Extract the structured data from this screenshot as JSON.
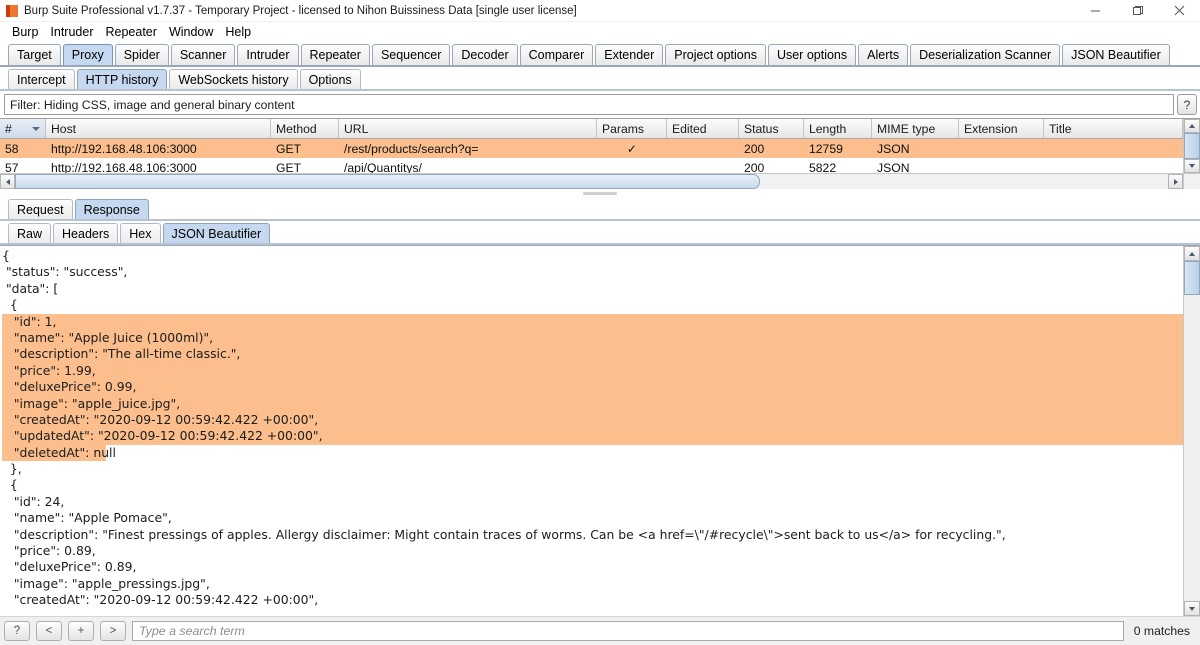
{
  "window": {
    "title": "Burp Suite Professional v1.7.37 - Temporary Project - licensed to Nihon Buissiness Data [single user license]",
    "minimize_label": "─",
    "maximize_label": "❐",
    "close_label": "✕"
  },
  "menubar": {
    "items": [
      "Burp",
      "Intruder",
      "Repeater",
      "Window",
      "Help"
    ]
  },
  "main_tabs": {
    "active": "Proxy",
    "items": [
      "Target",
      "Proxy",
      "Spider",
      "Scanner",
      "Intruder",
      "Repeater",
      "Sequencer",
      "Decoder",
      "Comparer",
      "Extender",
      "Project options",
      "User options",
      "Alerts",
      "Deserialization Scanner",
      "JSON Beautifier"
    ]
  },
  "proxy_tabs": {
    "active": "HTTP history",
    "items": [
      "Intercept",
      "HTTP history",
      "WebSockets history",
      "Options"
    ]
  },
  "filter": {
    "text": "Filter: Hiding CSS, image and general binary content",
    "help_label": "?"
  },
  "history_table": {
    "columns": [
      "#",
      "Host",
      "Method",
      "URL",
      "Params",
      "Edited",
      "Status",
      "Length",
      "MIME type",
      "Extension",
      "Title"
    ],
    "sorted_column": "#",
    "rows": [
      {
        "num": "58",
        "host": "http://192.168.48.106:3000",
        "method": "GET",
        "url": "/rest/products/search?q=",
        "params": "✓",
        "edited": "",
        "status": "200",
        "length": "12759",
        "mime": "JSON",
        "extension": "",
        "title": "",
        "selected": true
      },
      {
        "num": "57",
        "host": "http://192.168.48.106:3000",
        "method": "GET",
        "url": "/api/Quantitys/",
        "params": "",
        "edited": "",
        "status": "200",
        "length": "5822",
        "mime": "JSON",
        "extension": "",
        "title": "",
        "selected": false
      }
    ]
  },
  "message_tabs": {
    "active": "Response",
    "items": [
      "Request",
      "Response"
    ]
  },
  "view_tabs": {
    "active": "JSON Beautifier",
    "items": [
      "Raw",
      "Headers",
      "Hex",
      "JSON Beautifier"
    ]
  },
  "response_body": {
    "lines": [
      {
        "text": "{",
        "highlight": "none"
      },
      {
        "text": " \"status\": \"success\",",
        "highlight": "none"
      },
      {
        "text": " \"data\": [",
        "highlight": "none"
      },
      {
        "text": "  {",
        "highlight": "none"
      },
      {
        "text": "   \"id\": 1,",
        "highlight": "full"
      },
      {
        "text": "   \"name\": \"Apple Juice (1000ml)\",",
        "highlight": "full"
      },
      {
        "text": "   \"description\": \"The all-time classic.\",",
        "highlight": "full"
      },
      {
        "text": "   \"price\": 1.99,",
        "highlight": "full"
      },
      {
        "text": "   \"deluxePrice\": 0.99,",
        "highlight": "full"
      },
      {
        "text": "   \"image\": \"apple_juice.jpg\",",
        "highlight": "full"
      },
      {
        "text": "   \"createdAt\": \"2020-09-12 00:59:42.422 +00:00\",",
        "highlight": "full"
      },
      {
        "text": "   \"updatedAt\": \"2020-09-12 00:59:42.422 +00:00\",",
        "highlight": "full"
      },
      {
        "text": "   \"deletedAt\": null",
        "highlight": "partial"
      },
      {
        "text": "  },",
        "highlight": "none"
      },
      {
        "text": "  {",
        "highlight": "none"
      },
      {
        "text": "   \"id\": 24,",
        "highlight": "none"
      },
      {
        "text": "   \"name\": \"Apple Pomace\",",
        "highlight": "none"
      },
      {
        "text": "   \"description\": \"Finest pressings of apples. Allergy disclaimer: Might contain traces of worms. Can be <a href=\\\"/#recycle\\\">sent back to us</a> for recycling.\",",
        "highlight": "none"
      },
      {
        "text": "   \"price\": 0.89,",
        "highlight": "none"
      },
      {
        "text": "   \"deluxePrice\": 0.89,",
        "highlight": "none"
      },
      {
        "text": "   \"image\": \"apple_pressings.jpg\",",
        "highlight": "none"
      },
      {
        "text": "   \"createdAt\": \"2020-09-12 00:59:42.422 +00:00\",",
        "highlight": "none"
      }
    ]
  },
  "search": {
    "help_label": "?",
    "prev_label": "<",
    "add_label": "+",
    "next_label": ">",
    "placeholder": "Type a search term",
    "value": "",
    "matches": "0 matches"
  },
  "colors": {
    "selection": "#fbbe8c",
    "active_tab": "#c5d8ef",
    "accent": "#f0762c"
  }
}
